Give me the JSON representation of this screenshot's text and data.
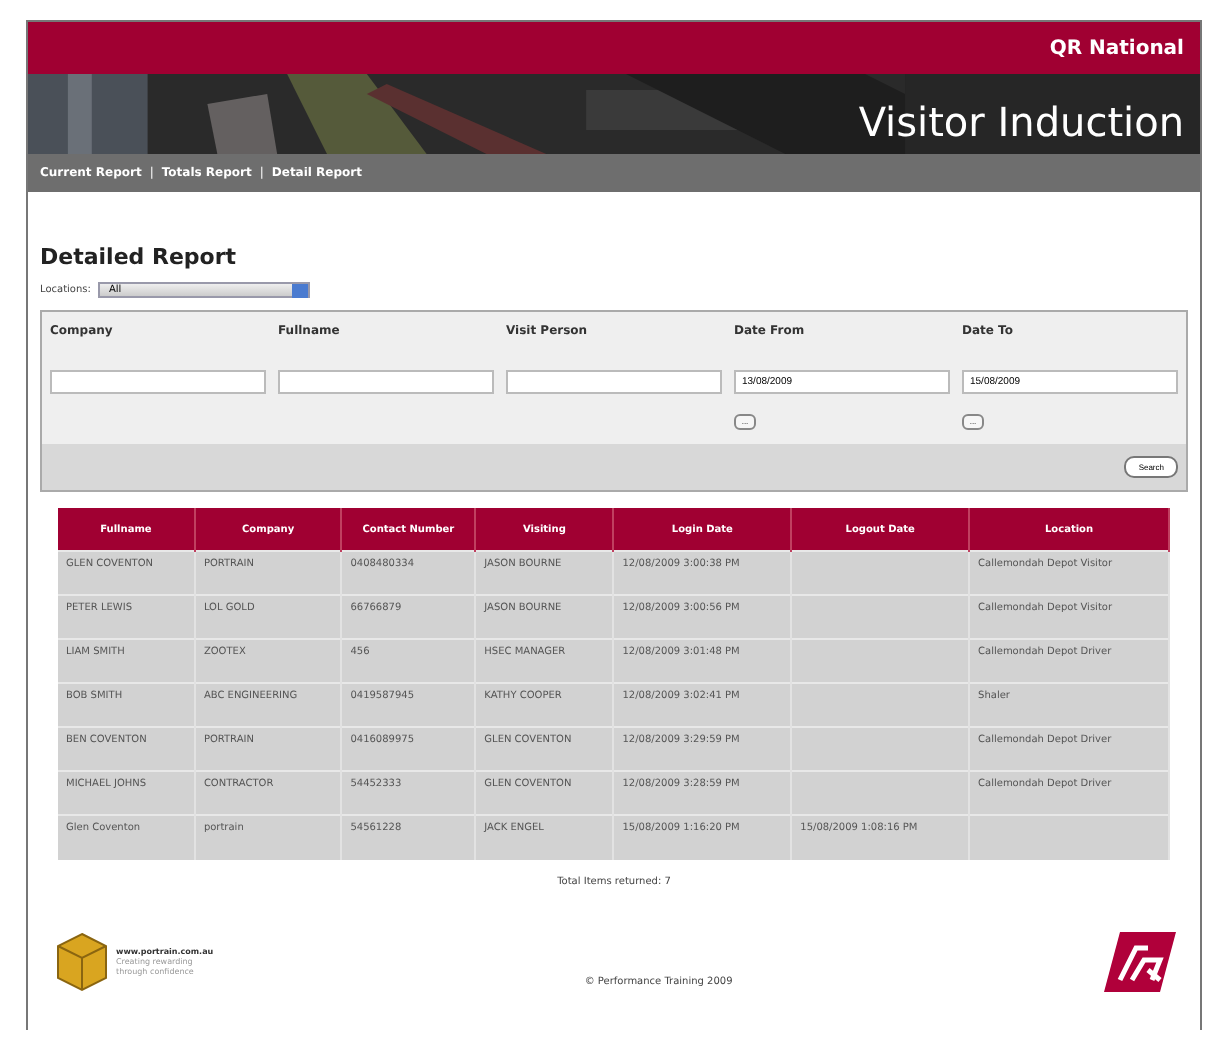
{
  "header": {
    "brand": "QR National",
    "title": "Visitor Induction"
  },
  "nav": [
    "Current Report",
    "Totals Report",
    "Detail Report"
  ],
  "nav_separator": "|",
  "page_title": "Detailed Report",
  "locations": {
    "label": "Locations:",
    "value": "All"
  },
  "filters": [
    {
      "label": "Company",
      "kind": "text"
    },
    {
      "label": "Fullname",
      "kind": "text"
    },
    {
      "label": "Visit Person",
      "kind": "text"
    },
    {
      "label": "Date From",
      "kind": "date",
      "value": "13/08/2009",
      "button": "..."
    },
    {
      "label": "Date To",
      "kind": "date",
      "value": "15/08/2009",
      "button": "..."
    }
  ],
  "search_button": "Search",
  "table": {
    "columns": [
      "Fullname",
      "Company",
      "Contact Number",
      "Visiting",
      "Login Date",
      "Logout Date",
      "Location"
    ],
    "rows": [
      [
        "GLEN COVENTON",
        "PORTRAIN",
        "0408480334",
        "JASON BOURNE",
        "12/08/2009 3:00:38 PM",
        "",
        "Callemondah Depot Visitor"
      ],
      [
        "PETER LEWIS",
        "LOL GOLD",
        "66766879",
        "JASON BOURNE",
        "12/08/2009 3:00:56 PM",
        "",
        "Callemondah Depot Visitor"
      ],
      [
        "LIAM SMITH",
        "ZOOTEX",
        "456",
        "HSEC MANAGER",
        "12/08/2009 3:01:48 PM",
        "",
        "Callemondah Depot Driver"
      ],
      [
        "BOB SMITH",
        "ABC ENGINEERING",
        "0419587945",
        "KATHY COOPER",
        "12/08/2009 3:02:41 PM",
        "",
        "Shaler"
      ],
      [
        "BEN COVENTON",
        "PORTRAIN",
        "0416089975",
        "GLEN COVENTON",
        "12/08/2009 3:29:59 PM",
        "",
        "Callemondah Depot Driver"
      ],
      [
        "MICHAEL JOHNS",
        "CONTRACTOR",
        "54452333",
        "GLEN COVENTON",
        "12/08/2009 3:28:59 PM",
        "",
        "Callemondah Depot Driver"
      ],
      [
        "Glen Coventon",
        "portrain",
        "54561228",
        "JACK ENGEL",
        "15/08/2009 1:16:20 PM",
        "15/08/2009 1:08:16 PM",
        ""
      ]
    ]
  },
  "total": "Total Items returned: 7",
  "footer": {
    "site": "www.portrain.com.au",
    "tagline": [
      "Creating rewarding",
      "through confidence"
    ],
    "copyright": "© Performance Training 2009"
  }
}
